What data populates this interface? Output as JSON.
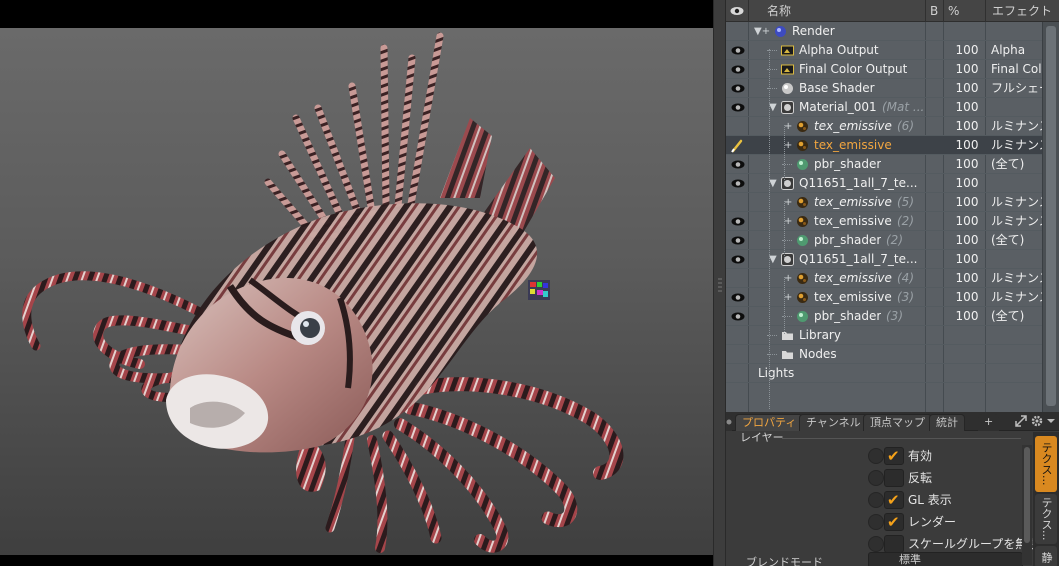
{
  "shader_tree": {
    "columns": {
      "visibility": "",
      "name": "名称",
      "blend": "B",
      "percent": "%",
      "effect": "エフェクト"
    },
    "rows": [
      {
        "name": "Render",
        "suffix": "",
        "percent": "",
        "effect": "",
        "icon": "render-sphere-icon",
        "visible": false,
        "italic": false,
        "selected": false
      },
      {
        "name": "Alpha Output",
        "suffix": "",
        "percent": "100",
        "effect": "Alpha",
        "icon": "output-icon",
        "visible": true,
        "italic": false,
        "selected": false
      },
      {
        "name": "Final Color Output",
        "suffix": "",
        "percent": "100",
        "effect": "Final Color",
        "icon": "output-icon",
        "visible": true,
        "italic": false,
        "selected": false
      },
      {
        "name": "Base Shader",
        "suffix": "",
        "percent": "100",
        "effect": "フルシェーデ",
        "icon": "shader-ball-icon",
        "visible": true,
        "italic": false,
        "selected": false
      },
      {
        "name": "Material_001",
        "suffix": "(Mat ...",
        "percent": "100",
        "effect": "",
        "icon": "material-group-icon",
        "visible": true,
        "italic": false,
        "selected": false
      },
      {
        "name": "tex_emissive",
        "suffix": "(6)",
        "percent": "100",
        "effect": "ルミナンスの",
        "icon": "texture-ball-icon",
        "visible": false,
        "italic": true,
        "selected": false
      },
      {
        "name": "tex_emissive",
        "suffix": "",
        "percent": "100",
        "effect": "ルミナンスの",
        "icon": "texture-ball-icon",
        "visible": true,
        "italic": false,
        "selected": true
      },
      {
        "name": "pbr_shader",
        "suffix": "",
        "percent": "100",
        "effect": "(全て)",
        "icon": "pbr-ball-icon",
        "visible": true,
        "italic": false,
        "selected": false
      },
      {
        "name": "Q11651_1all_7_te...",
        "suffix": "",
        "percent": "100",
        "effect": "",
        "icon": "material-group-icon",
        "visible": true,
        "italic": false,
        "selected": false
      },
      {
        "name": "tex_emissive",
        "suffix": "(5)",
        "percent": "100",
        "effect": "ルミナンスの",
        "icon": "texture-ball-icon",
        "visible": false,
        "italic": true,
        "selected": false
      },
      {
        "name": "tex_emissive",
        "suffix": "(2)",
        "percent": "100",
        "effect": "ルミナンスの",
        "icon": "texture-ball-icon",
        "visible": true,
        "italic": false,
        "selected": false
      },
      {
        "name": "pbr_shader",
        "suffix": "(2)",
        "percent": "100",
        "effect": "(全て)",
        "icon": "pbr-ball-icon",
        "visible": true,
        "italic": false,
        "selected": false
      },
      {
        "name": "Q11651_1all_7_te...",
        "suffix": "",
        "percent": "100",
        "effect": "",
        "icon": "material-group-icon",
        "visible": true,
        "italic": false,
        "selected": false
      },
      {
        "name": "tex_emissive",
        "suffix": "(4)",
        "percent": "100",
        "effect": "ルミナンスの",
        "icon": "texture-ball-icon",
        "visible": false,
        "italic": true,
        "selected": false
      },
      {
        "name": "tex_emissive",
        "suffix": "(3)",
        "percent": "100",
        "effect": "ルミナンスの",
        "icon": "texture-ball-icon",
        "visible": true,
        "italic": false,
        "selected": false
      },
      {
        "name": "pbr_shader",
        "suffix": "(3)",
        "percent": "100",
        "effect": "(全て)",
        "icon": "pbr-ball-icon",
        "visible": true,
        "italic": false,
        "selected": false
      },
      {
        "name": "Library",
        "suffix": "",
        "percent": "",
        "effect": "",
        "icon": "folder-icon",
        "visible": false,
        "italic": false,
        "selected": false
      },
      {
        "name": "Nodes",
        "suffix": "",
        "percent": "",
        "effect": "",
        "icon": "folder-icon",
        "visible": false,
        "italic": false,
        "selected": false
      },
      {
        "name": "Lights",
        "suffix": "",
        "percent": "",
        "effect": "",
        "icon": "",
        "visible": false,
        "italic": false,
        "selected": false
      }
    ]
  },
  "properties": {
    "tabs": [
      "プロパティ",
      "チャンネル",
      "頂点マップ",
      "統計",
      "+"
    ],
    "active_tab": "プロパティ",
    "section_label": "レイヤー",
    "checkboxes": [
      {
        "label": "有効",
        "checked": true
      },
      {
        "label": "反転",
        "checked": false
      },
      {
        "label": "GL 表示",
        "checked": true
      },
      {
        "label": "レンダー",
        "checked": true
      },
      {
        "label": "スケールグループを無視",
        "checked": false
      }
    ],
    "blend_mode_label": "ブレンドモード",
    "blend_mode_value": "標準",
    "side_tabs": [
      "テクス...",
      "テクス...",
      "静"
    ]
  },
  "colors": {
    "accent": "#f2a640",
    "selected_row": "#3d4248",
    "tree_bg": "#5a5f64",
    "panel_bg": "#3b3b3b"
  }
}
